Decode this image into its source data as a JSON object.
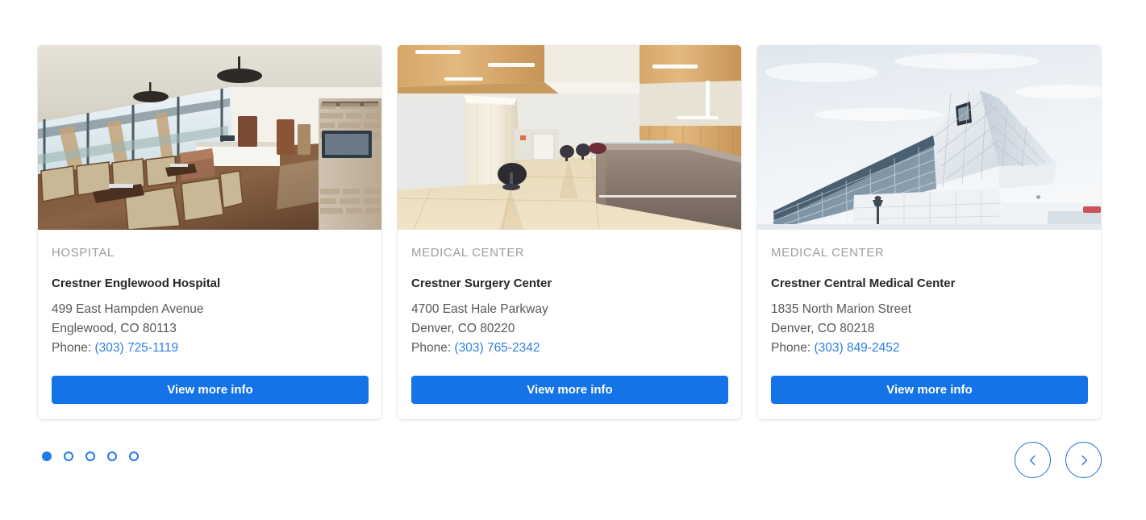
{
  "carousel": {
    "cards": [
      {
        "eyebrow": "HOSPITAL",
        "title": "Crestner Englewood Hospital",
        "address_line1": "499 East Hampden Avenue",
        "address_line2": "Englewood, CO 80113",
        "phone_label": "Phone:",
        "phone": "(303) 725-1119",
        "cta_label": "View more info",
        "image_alt": "hospital-waiting-room-photo"
      },
      {
        "eyebrow": "MEDICAL CENTER",
        "title": "Crestner Surgery Center",
        "address_line1": "4700 East Hale Parkway",
        "address_line2": "Denver, CO 80220",
        "phone_label": "Phone:",
        "phone": "(303) 765-2342",
        "cta_label": "View more info",
        "image_alt": "medical-center-lobby-photo"
      },
      {
        "eyebrow": "MEDICAL CENTER",
        "title": "Crestner Central Medical Center",
        "address_line1": "1835 North Marion Street",
        "address_line2": "Denver, CO 80218",
        "phone_label": "Phone:",
        "phone": "(303) 849-2452",
        "cta_label": "View more info",
        "image_alt": "modern-building-exterior-photo"
      }
    ],
    "pagination": {
      "total": 5,
      "active_index": 0
    },
    "nav": {
      "prev_icon": "chevron-left-icon",
      "next_icon": "chevron-right-icon"
    }
  },
  "colors": {
    "accent_blue": "#1473e6",
    "link_blue": "#2e7fe0",
    "dot_blue": "#1f7ae8",
    "arrow_blue": "#2176dd",
    "eyebrow_gray": "#9d9d9d",
    "title_dark": "#262626",
    "body_gray": "#585858"
  }
}
